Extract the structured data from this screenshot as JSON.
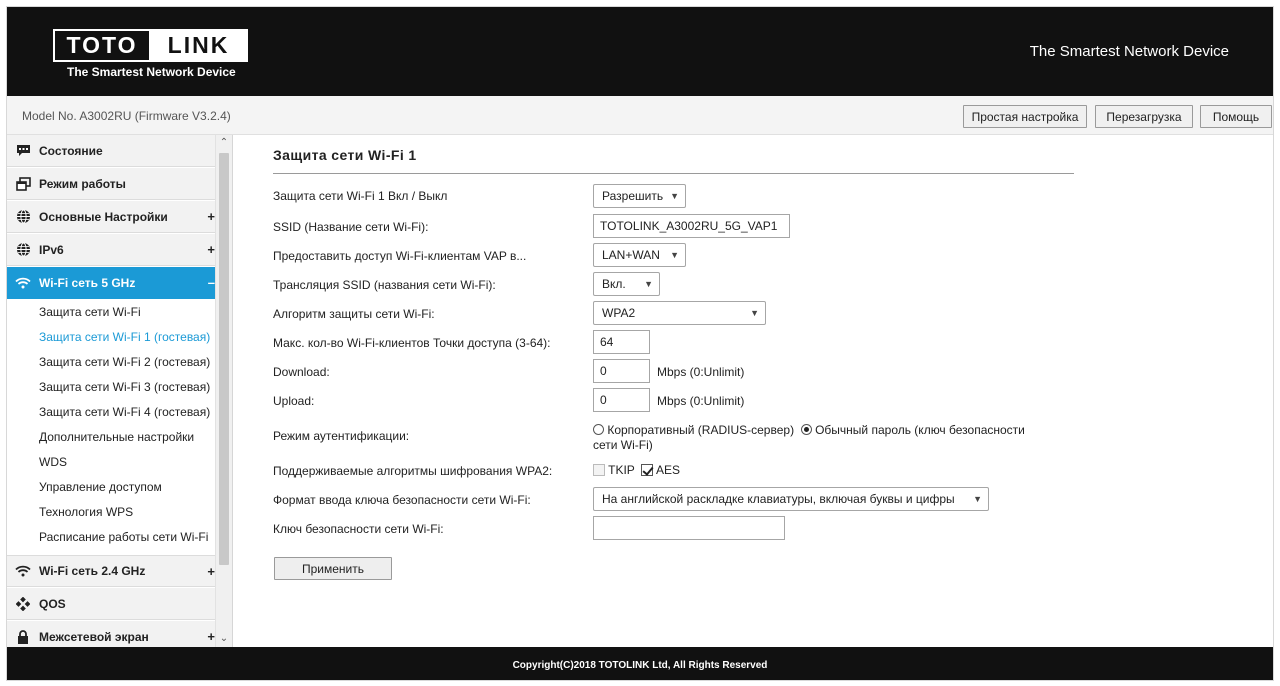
{
  "header": {
    "logo_left": "TOTO",
    "logo_right": "LINK",
    "logo_tagline": "The Smartest Network Device",
    "slogan": "The Smartest Network Device"
  },
  "modelbar": {
    "model": "Model No. A3002RU (Firmware V3.2.4)",
    "buttons": [
      "Простая настройка",
      "Перезагрузка",
      "Помощь"
    ]
  },
  "sidebar": {
    "items": [
      {
        "label": "Состояние",
        "icon": "chat-bubble-icon",
        "plus": ""
      },
      {
        "label": "Режим работы",
        "icon": "windows-icon",
        "plus": ""
      },
      {
        "label": "Основные Настройки",
        "icon": "globe-icon",
        "plus": "+"
      },
      {
        "label": "IPv6",
        "icon": "globe-icon",
        "plus": "+"
      },
      {
        "label": "Wi-Fi сеть 5 GHz",
        "icon": "wifi-icon",
        "plus": "–"
      }
    ],
    "subitems": [
      "Защита сети Wi-Fi",
      "Защита сети Wi-Fi 1 (гостевая)",
      "Защита сети Wi-Fi 2 (гостевая)",
      "Защита сети Wi-Fi 3 (гостевая)",
      "Защита сети Wi-Fi 4 (гостевая)",
      "Дополнительные настройки",
      "WDS",
      "Управление доступом",
      "Технология WPS",
      "Расписание работы сети Wi-Fi"
    ],
    "items_after": [
      {
        "label": "Wi-Fi сеть 2.4 GHz",
        "icon": "wifi-icon",
        "plus": "+"
      },
      {
        "label": "QOS",
        "icon": "qos-icon",
        "plus": ""
      },
      {
        "label": "Межсетевой экран",
        "icon": "lock-icon",
        "plus": "+"
      }
    ],
    "accent": "#1b9ad6"
  },
  "form": {
    "title": "Защита сети Wi-Fi 1",
    "enable_label": "Защита сети Wi-Fi 1 Вкл / Выкл",
    "enable_value": "Разрешить",
    "ssid_label": "SSID (Название сети Wi-Fi):",
    "ssid_value": "TOTOLINK_A3002RU_5G_VAP1",
    "access_label": "Предоставить доступ Wi-Fi-клиентам VAP в...",
    "access_value": "LAN+WAN",
    "broadcast_label": "Трансляция SSID (названия сети Wi-Fi):",
    "broadcast_value": "Вкл.",
    "algo_label": "Алгоритм защиты сети Wi-Fi:",
    "algo_value": "WPA2",
    "maxclients_label": "Макс. кол-во Wi-Fi-клиентов Точки доступа (3-64):",
    "maxclients_value": "64",
    "download_label": "Download:",
    "download_value": "0",
    "download_unit": "Mbps (0:Unlimit)",
    "upload_label": "Upload:",
    "upload_value": "0",
    "upload_unit": "Mbps (0:Unlimit)",
    "auth_label": "Режим аутентификации:",
    "auth_enterprise": "Корпоративный (RADIUS-сервер)",
    "auth_personal_1": "Обычный пароль (ключ безопасности",
    "auth_personal_2": "сети Wi-Fi)",
    "cipher_label": "Поддерживаемые алгоритмы шифрования WPA2:",
    "cipher_tkip": "TKIP",
    "cipher_aes": "AES",
    "keyformat_label": "Формат ввода ключа безопасности сети Wi-Fi:",
    "keyformat_value": "На английской раскладке клавиатуры, включая буквы и цифры",
    "key_label": "Ключ безопасности сети Wi-Fi:",
    "key_value": "",
    "apply": "Применить"
  },
  "footer": {
    "copyright": "Copyright(C)2018 TOTOLINK Ltd, All Rights Reserved"
  }
}
